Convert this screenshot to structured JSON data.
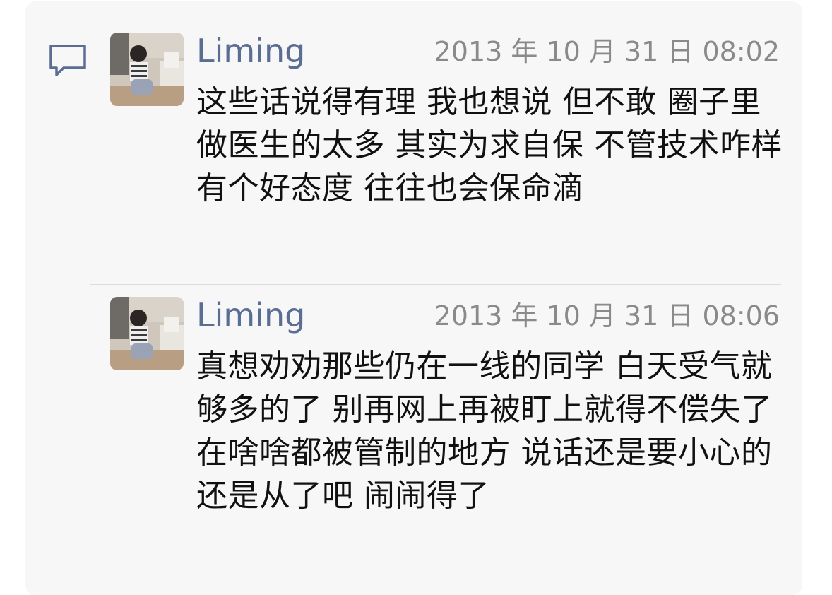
{
  "icons": {
    "comment": "comment-bubble-icon",
    "avatar": "user-photo-avatar"
  },
  "colors": {
    "author_name": "#5a6d93",
    "timestamp": "#8a8a8a",
    "panel_bg": "#f7f7f7",
    "text": "#111111"
  },
  "comments": [
    {
      "author": "Liming",
      "timestamp": "2013 年 10 月 31 日 08:02",
      "text": "这些话说得有理 我也想说 但不敢 圈子里做医生的太多 其实为求自保 不管技术咋样 有个好态度 往往也会保命滴"
    },
    {
      "author": "Liming",
      "timestamp": "2013 年 10 月 31 日 08:06",
      "text": "真想劝劝那些仍在一线的同学 白天受气就够多的了 别再网上再被盯上就得不偿失了 在啥啥都被管制的地方 说话还是要小心的 还是从了吧 闹闹得了"
    }
  ]
}
